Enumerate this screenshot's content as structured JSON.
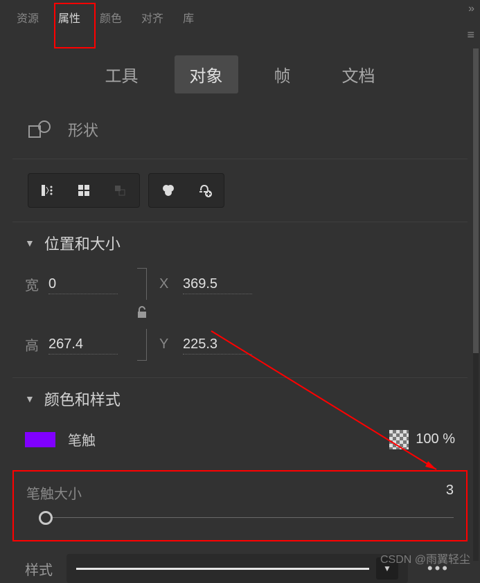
{
  "panel_tabs": [
    "资源",
    "属性",
    "颜色",
    "对齐",
    "库"
  ],
  "panel_tabs_active": "属性",
  "sub_tabs": [
    "工具",
    "对象",
    "帧",
    "文档"
  ],
  "sub_tabs_active": "对象",
  "shape_label": "形状",
  "sections": {
    "pos": {
      "title": "位置和大小",
      "width_label": "宽",
      "width_value": "0",
      "height_label": "高",
      "height_value": "267.4",
      "x_label": "X",
      "x_value": "369.5",
      "y_label": "Y",
      "y_value": "225.3"
    },
    "color": {
      "title": "颜色和样式",
      "stroke_label": "笔触",
      "stroke_color": "#8000ff",
      "alpha_text": "100 %"
    }
  },
  "stroke_size_label": "笔触大小",
  "stroke_size_value": "3",
  "style_label": "样式",
  "watermark": "CSDN @雨翼轻尘"
}
